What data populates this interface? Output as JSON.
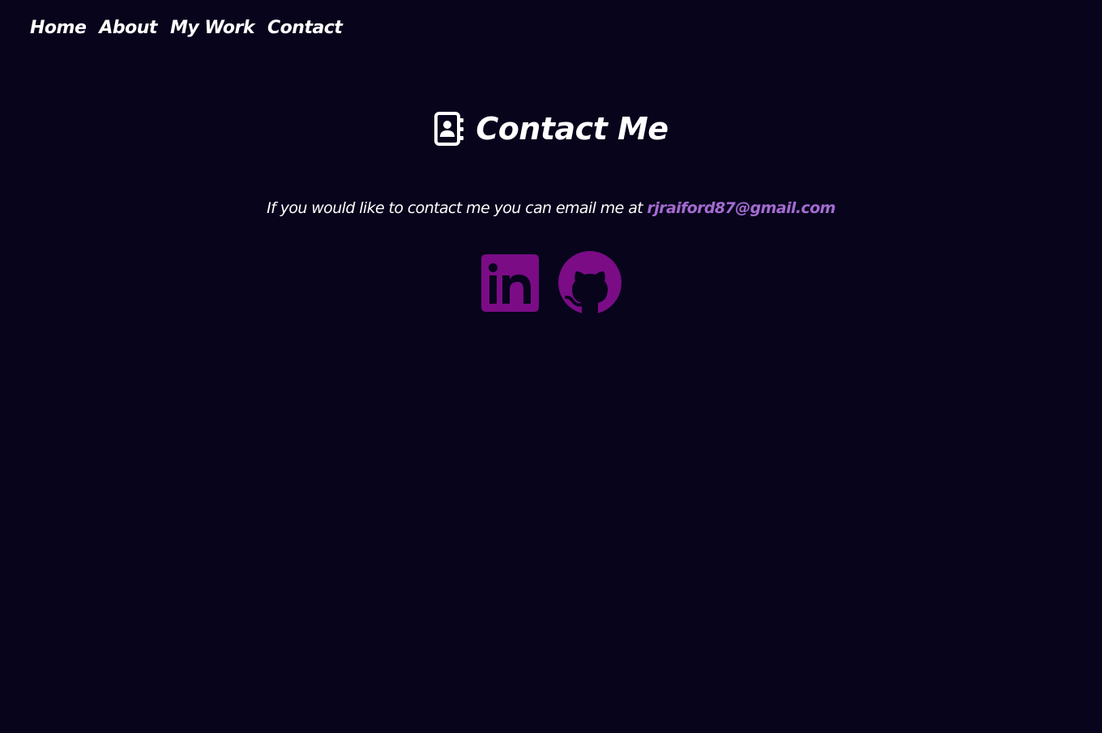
{
  "nav": {
    "items": [
      {
        "label": "Home"
      },
      {
        "label": "About"
      },
      {
        "label": "My Work"
      },
      {
        "label": "Contact"
      }
    ]
  },
  "contact": {
    "icon": "address-book-icon",
    "title": "Contact Me",
    "message": "If you would like to contact me you can email me at ",
    "email": "rjraiford87@gmail.com"
  },
  "socials": [
    {
      "icon": "linkedin-icon"
    },
    {
      "icon": "github-icon"
    }
  ],
  "colors": {
    "background": "#07041c",
    "text": "#ffffff",
    "email_link": "#a46bd1",
    "social_icon": "#7b0c86"
  }
}
